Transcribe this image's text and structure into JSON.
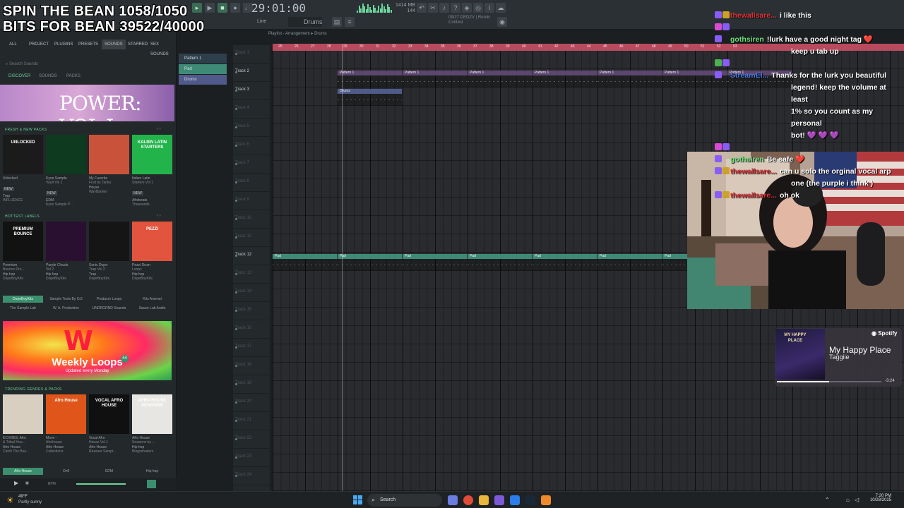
{
  "overlay": {
    "line1": "SPIN THE BEAN 1058/1050",
    "line2": "BITS FOR BEAN 39522/40000"
  },
  "toolbar": {
    "time": "29:01:00",
    "snap_label": "Line",
    "pattern": "Drums",
    "cpu_memory": "1414 MB",
    "cpu_polyphony": "144",
    "hint_line1": "09/27  DEDZV | Remix",
    "hint_line2": "Contest"
  },
  "browser": {
    "tabs": [
      "ALL",
      "PROJECT",
      "PLUGINS",
      "PRESETS",
      "SOUNDS",
      "STARRED",
      "SEX SOUNDS"
    ],
    "active_tab": "SOUNDS",
    "search_placeholder": "Search Sounds",
    "subtabs": [
      "DISCOVER",
      "SOUNDS",
      "PACKS"
    ],
    "active_subtab": "DISCOVER",
    "hero": "POWER: VOL I",
    "sections": [
      {
        "title": "FRESH & NEW PACKS",
        "cards": [
          {
            "name": "Unlocked",
            "sub": "",
            "tag": "NEW",
            "genre": "Trap",
            "author": "INFLUENCE"
          },
          {
            "name": "Kyoo Sample",
            "sub": "Vault Vol 1",
            "tag": "NEW",
            "genre": "EDM",
            "author": "Kyoo Sample P..."
          },
          {
            "name": "My Favorite",
            "sub": "Fruit by Tanku",
            "tag": "",
            "genre": "House",
            "author": "WavBarden"
          },
          {
            "name": "Italien Latin",
            "sub": "Starters Vol 1",
            "tag": "NEW",
            "genre": "Afrobeats",
            "author": "Thasounds"
          }
        ],
        "card_colors": [
          "#1b1b1b",
          "#0e3a1f",
          "#c9533a",
          "#22b34a"
        ],
        "card_labels": [
          "UNLOCKED",
          "",
          "",
          "KALIEN LATIN STARTERS"
        ]
      },
      {
        "title": "HOTTEST LABELS",
        "cards": [
          {
            "name": "Premium",
            "sub": "Bounce Dru...",
            "tag": "",
            "genre": "Hip hop",
            "author": "DopeBoyKits"
          },
          {
            "name": "Purple Clouds",
            "sub": "Vol 2",
            "tag": "",
            "genre": "Hip hop",
            "author": "DopeBoyKits"
          },
          {
            "name": "Sonic Dope:",
            "sub": "Trap Vol 2",
            "tag": "",
            "genre": "Trap",
            "author": "DopeBoyKits"
          },
          {
            "name": "Pezzi Drum",
            "sub": "Loops",
            "tag": "",
            "genre": "Hip hop",
            "author": "DopeBoyKits"
          }
        ],
        "card_colors": [
          "#121212",
          "#2a1030",
          "#151515",
          "#e2543d"
        ],
        "card_labels": [
          "PREMIUM BOUNCE",
          "",
          "",
          "PEZZI"
        ]
      }
    ],
    "label_chips": [
      [
        "DopeBoyKits",
        "Sample Tools By Cr2",
        "Producer Loops",
        "Kits Arsenal"
      ],
      [
        "The Sample Lab",
        "W. A. Production",
        "UNDRGRND Sounds",
        "Sauce Lab Audio"
      ]
    ],
    "weekly": {
      "logo": "W",
      "title": "Weekly Loops",
      "subtitle": "Updated every Monday",
      "badge": "44"
    },
    "trending_title": "TRENDING GENRES & PACKS",
    "trending": [
      {
        "name": "ECHOES: Afro",
        "sub": "& Tribal Hou...",
        "genre": "Afro House",
        "author": "Catch The Bey..."
      },
      {
        "name": "Move -",
        "sub": "Afrohouse",
        "genre": "Afro House",
        "author": "Collections"
      },
      {
        "name": "Vocal Afro",
        "sub": "House Vol 1",
        "genre": "Afro House",
        "author": "Reasser Sampl..."
      },
      {
        "name": "Afro House",
        "sub": "Sessions by ...",
        "genre": "Hip hop",
        "author": "Bingoshakerz"
      }
    ],
    "trending_colors": [
      "#d9cfc0",
      "#e0561a",
      "#101010",
      "#e8e6e2"
    ],
    "trending_labels": [
      "",
      "Afro House",
      "VOCAL AFRO HOUSE",
      "AFRO HOUSE SESSIONS"
    ],
    "genre_chips": [
      "Afro House",
      "Drill",
      "EDM",
      "Hip hop"
    ],
    "footer_bpm": "BPM"
  },
  "patterns": [
    {
      "name": "Pattern 1",
      "color": "#2d3f4a"
    },
    {
      "name": "Pad",
      "color": "#3f8a76"
    },
    {
      "name": "Drums",
      "color": "#4f5a8a"
    }
  ],
  "playlist": {
    "title": "Playlist - Arrangement",
    "pattern": "Drums",
    "ruler": [
      "25",
      "26",
      "27",
      "28",
      "29",
      "30",
      "31",
      "32",
      "33",
      "34",
      "35",
      "36",
      "37",
      "38",
      "39",
      "40",
      "41",
      "42",
      "43",
      "44",
      "45",
      "46",
      "47",
      "48",
      "49",
      "50",
      "51",
      "52",
      "53"
    ],
    "tracks": [
      "Track 1",
      "Track 2",
      "Track 3",
      "Track 4",
      "Track 5",
      "Track 6",
      "Track 7",
      "Track 8",
      "Track 9",
      "Track 10",
      "Track 11",
      "Track 12",
      "Track 13",
      "Track 14",
      "Track 15",
      "Track 16",
      "Track 17",
      "Track 18",
      "Track 19",
      "Track 20",
      "Track 21",
      "Track 22",
      "Track 23",
      "Track 24"
    ],
    "used_tracks": [
      "Track 2",
      "Track 3",
      "Track 12"
    ],
    "clips": [
      {
        "track": 1,
        "label": "Pattern 1",
        "start": 4,
        "len": 4,
        "color": "#5c4670"
      },
      {
        "track": 1,
        "label": "Pattern 1",
        "start": 8,
        "len": 4,
        "color": "#5c4670"
      },
      {
        "track": 1,
        "label": "Pattern 1",
        "start": 12,
        "len": 4,
        "color": "#5c4670"
      },
      {
        "track": 1,
        "label": "Pattern 1",
        "start": 16,
        "len": 4,
        "color": "#5c4670"
      },
      {
        "track": 1,
        "label": "Pattern 1",
        "start": 20,
        "len": 4,
        "color": "#5c4670"
      },
      {
        "track": 1,
        "label": "Pattern 1",
        "start": 24,
        "len": 4,
        "color": "#5c4670"
      },
      {
        "track": 1,
        "label": "Pattern 1",
        "start": 28,
        "len": 4,
        "color": "#5c4670"
      },
      {
        "track": 2,
        "label": "Drums",
        "start": 4,
        "len": 4,
        "color": "#4f5a8a"
      },
      {
        "track": 11,
        "label": "Pad",
        "start": 0,
        "len": 4,
        "color": "#3f8a76"
      },
      {
        "track": 11,
        "label": "Pad",
        "start": 4,
        "len": 4,
        "color": "#3f8a76"
      },
      {
        "track": 11,
        "label": "Pad",
        "start": 8,
        "len": 4,
        "color": "#3f8a76"
      },
      {
        "track": 11,
        "label": "Pad",
        "start": 12,
        "len": 4,
        "color": "#3f8a76"
      },
      {
        "track": 11,
        "label": "Pad",
        "start": 16,
        "len": 4,
        "color": "#3f8a76"
      },
      {
        "track": 11,
        "label": "Pad",
        "start": 20,
        "len": 4,
        "color": "#3f8a76"
      },
      {
        "track": 11,
        "label": "Pad",
        "start": 24,
        "len": 4,
        "color": "#3f8a76"
      }
    ]
  },
  "chat": [
    {
      "user": "thewallsare...",
      "color": "#e0353a",
      "badges": [
        "#8a5cf6",
        "#c9a227"
      ],
      "lines": [
        "i like this"
      ]
    },
    {
      "user": "gothsiren",
      "color": "#6fe07a",
      "badges": [
        "#d94bd0",
        "#8a5cf6",
        "#8a5cf6"
      ],
      "lines": [
        "!lurk have a good night tag ❤️",
        "keep u tab up"
      ]
    },
    {
      "user": "StreamEl...",
      "color": "#4c7ee0",
      "badges": [
        "#4caf50",
        "#8a5cf6",
        "#8a5cf6"
      ],
      "lines": [
        "Thanks for the lurk you beautiful",
        "legend! keep the volume at least",
        "1% so you count as my personal",
        "bot! 💜 💜 💜"
      ]
    },
    {
      "user": "gothsiren",
      "color": "#6fe07a",
      "badges": [
        "#d94bd0",
        "#8a5cf6",
        "#8a5cf6"
      ],
      "lines": [
        "Be safe ❤️"
      ]
    },
    {
      "user": "thewallsare...",
      "color": "#e0353a",
      "badges": [
        "#8a5cf6",
        "#c9a227"
      ],
      "lines": [
        "can u solo the orginal vocal arp",
        "one (the purple i think )"
      ]
    },
    {
      "user": "thewallsare...",
      "color": "#e0353a",
      "badges": [
        "#8a5cf6",
        "#c9a227"
      ],
      "lines": [
        "oh ok"
      ]
    }
  ],
  "spotify": {
    "brand": "Spotify",
    "art_text": "MY HAPPY PLACE",
    "title": "My Happy Place",
    "artist": "Taggiie",
    "remaining": "-3:24",
    "progress": 0.5
  },
  "taskbar": {
    "temp": "49°F",
    "weather": "Partly sunny",
    "search": "Search",
    "time": "7:20 PM",
    "date": "10/28/2025"
  }
}
